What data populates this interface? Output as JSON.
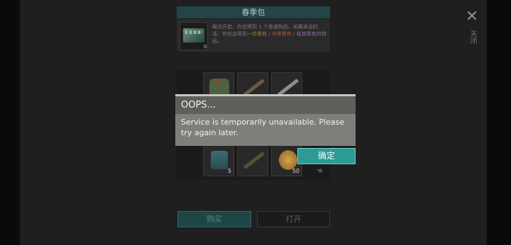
{
  "close": {
    "icon": "close-icon",
    "label": "关闭"
  },
  "pack": {
    "title": "春季包",
    "count": "0",
    "description_prefix": "每次开启，你会得到 1 个普通物品。如果幸运的话，你也会得到",
    "rare": "一件稀有",
    "sep1": " / ",
    "epic": "非常稀有",
    "sep2": " / ",
    "legend": "极其稀有",
    "description_suffix": "的物品。"
  },
  "rewards": {
    "slots": [
      {
        "name": "medkit",
        "qty": ""
      },
      {
        "name": "rifle",
        "qty": ""
      },
      {
        "name": "sniper-rifle",
        "qty": ""
      },
      {
        "name": "backpack",
        "qty": "5"
      },
      {
        "name": "camo-rifle",
        "qty": ""
      },
      {
        "name": "coin",
        "qty": "50"
      }
    ]
  },
  "buttons": {
    "buy": "购买",
    "open": "打开",
    "ok": "确定"
  },
  "dialog": {
    "title": "OOPS...",
    "message": "Service is temporarily unavailable. Please try again later."
  },
  "colors": {
    "accent": "#2e9a94",
    "rare": "#a07a2c",
    "epic": "#b0563d",
    "legend": "#8a68a8"
  }
}
